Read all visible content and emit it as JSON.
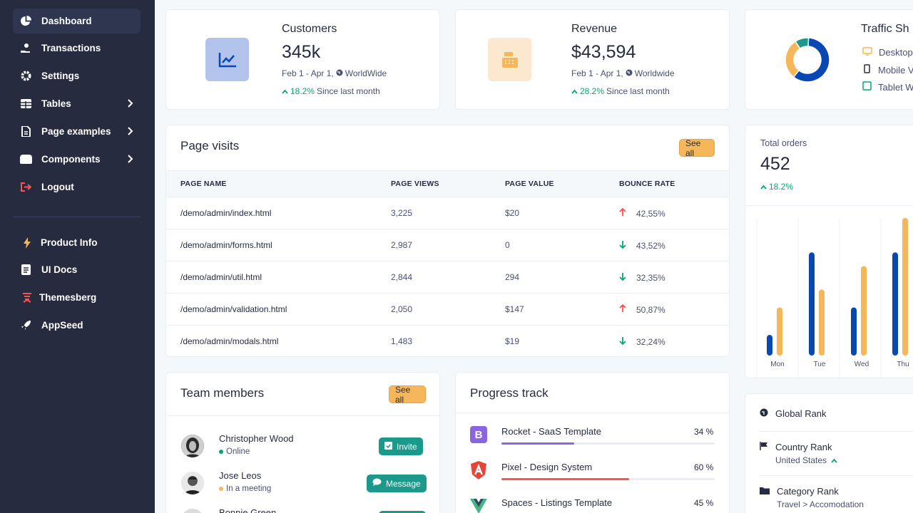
{
  "sidebar": {
    "items": [
      {
        "label": "Dashboard",
        "icon": "pie-chart-icon"
      },
      {
        "label": "Transactions",
        "icon": "hand-coin-icon"
      },
      {
        "label": "Settings",
        "icon": "gear-icon"
      },
      {
        "label": "Tables",
        "icon": "table-icon"
      },
      {
        "label": "Page examples",
        "icon": "document-icon"
      },
      {
        "label": "Components",
        "icon": "box-icon"
      },
      {
        "label": "Logout",
        "icon": "logout-icon"
      }
    ],
    "secondary": [
      {
        "label": "Product Info",
        "icon": "bolt-icon"
      },
      {
        "label": "UI Docs",
        "icon": "book-icon"
      },
      {
        "label": "Themesberg",
        "icon": "themesberg-logo-icon"
      },
      {
        "label": "AppSeed",
        "icon": "rocket-icon"
      }
    ]
  },
  "kpis": [
    {
      "title": "Customers",
      "value": "345k",
      "period": "Feb 1 - Apr 1,",
      "region": "WorldWide",
      "change": "18.2%",
      "change_label": "Since last month",
      "icon": "chart-line-icon",
      "color": "#b3c4ec"
    },
    {
      "title": "Revenue",
      "value": "$43,594",
      "period": "Feb 1 - Apr 1,",
      "region": "Worldwide",
      "change": "28.2%",
      "change_label": "Since last month",
      "icon": "cash-register-icon",
      "color": "#fce8cf"
    }
  ],
  "traffic": {
    "title": "Traffic Sh",
    "legend": [
      {
        "label": "Desktop",
        "color": "#f5b759",
        "icon": "desktop-icon"
      },
      {
        "label": "Mobile V",
        "color": "#262b40",
        "icon": "mobile-icon"
      },
      {
        "label": "Tablet W",
        "color": "#05a677",
        "icon": "tablet-icon"
      }
    ],
    "shares": [
      {
        "label": "Desktop",
        "value": 60
      },
      {
        "label": "Mobile",
        "value": 30
      },
      {
        "label": "Tablet",
        "value": 10
      }
    ],
    "colors": [
      "#0948b3",
      "#f5b759",
      "#1b998b"
    ]
  },
  "page_visits": {
    "title": "Page visits",
    "see_all": "See all",
    "headers": [
      "PAGE NAME",
      "PAGE VIEWS",
      "PAGE VALUE",
      "BOUNCE RATE"
    ],
    "rows": [
      {
        "name": "/demo/admin/index.html",
        "views": "3,225",
        "value": "$20",
        "bounce": "42,55%",
        "dir": "up"
      },
      {
        "name": "/demo/admin/forms.html",
        "views": "2,987",
        "value": "0",
        "bounce": "43,52%",
        "dir": "down"
      },
      {
        "name": "/demo/admin/util.html",
        "views": "2,844",
        "value": "294",
        "bounce": "32,35%",
        "dir": "down"
      },
      {
        "name": "/demo/admin/validation.html",
        "views": "2,050",
        "value": "$147",
        "bounce": "50,87%",
        "dir": "up"
      },
      {
        "name": "/demo/admin/modals.html",
        "views": "1,483",
        "value": "$19",
        "bounce": "32,24%",
        "dir": "down"
      }
    ]
  },
  "total_orders": {
    "label": "Total orders",
    "value": "452",
    "change": "18.2%"
  },
  "chart_data": {
    "type": "bar",
    "categories": [
      "Mon",
      "Tue",
      "Wed",
      "Thu"
    ],
    "series": [
      {
        "values": [
          15,
          75,
          35,
          75
        ]
      },
      {
        "values": [
          35,
          48,
          65,
          100
        ]
      }
    ],
    "colors": [
      "#0948b3",
      "#f5b759"
    ],
    "ylim": [
      0,
      100
    ]
  },
  "team": {
    "title": "Team members",
    "see_all": "See all",
    "members": [
      {
        "name": "Christopher Wood",
        "status": "Online",
        "status_color": "#05a677",
        "action": "Invite",
        "action_icon": "calendar-check-icon"
      },
      {
        "name": "Jose Leos",
        "status": "In a meeting",
        "status_color": "#f5b759",
        "action": "Message",
        "action_icon": "chat-icon"
      },
      {
        "name": "Bonnie Green",
        "status": "",
        "status_color": "#05a677",
        "action": "",
        "action_icon": ""
      }
    ]
  },
  "progress": {
    "title": "Progress track",
    "items": [
      {
        "name": "Rocket - SaaS Template",
        "pct": "34 %",
        "value": 34,
        "color": "#8965e0",
        "logo": "B",
        "logo_bg": "#8965e0"
      },
      {
        "name": "Pixel - Design System",
        "pct": "60 %",
        "value": 60,
        "color": "#fa5252",
        "logo": "A",
        "logo_bg": "#e4463c"
      },
      {
        "name": "Spaces - Listings Template",
        "pct": "45 %",
        "value": 45,
        "color": "#1b998b",
        "logo": "V",
        "logo_bg": "#41b883"
      }
    ]
  },
  "rankings": {
    "global": "Global Rank",
    "country": "Country Rank",
    "country_value": "United States",
    "category": "Category Rank",
    "category_value": "Travel > Accomodation"
  }
}
